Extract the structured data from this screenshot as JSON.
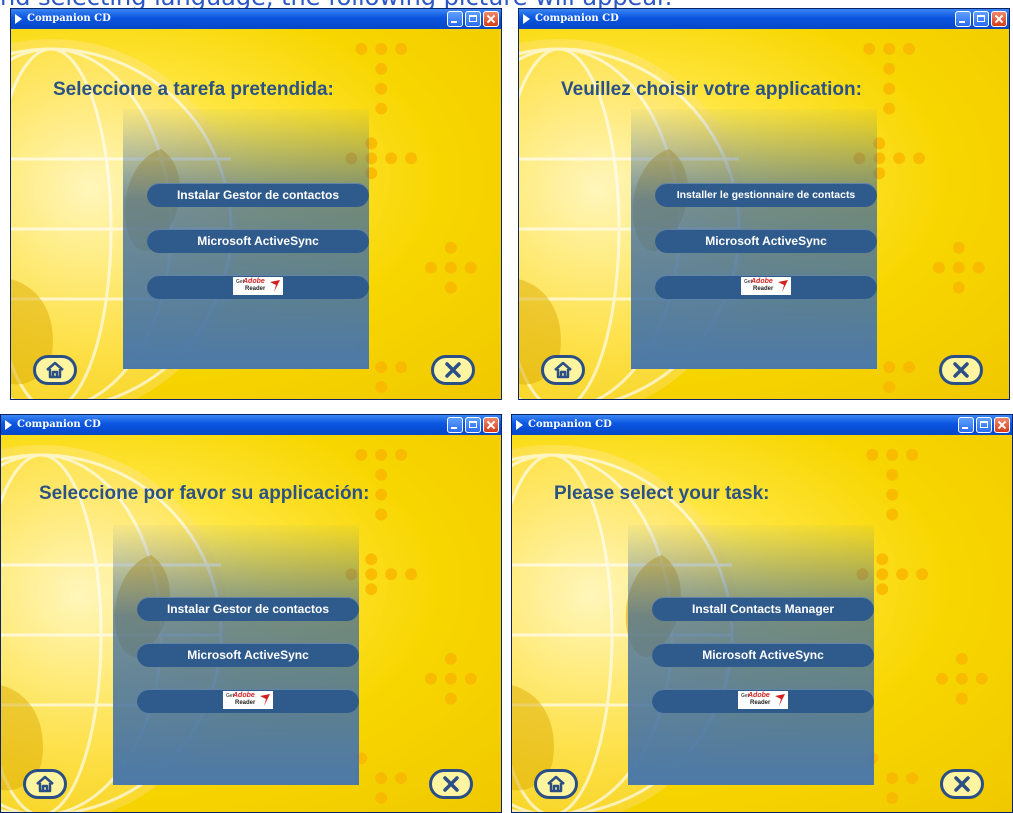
{
  "caption": "nd selecting language, the following picture will appear.",
  "colors": {
    "title_bar": "#0a55e0",
    "background": "#f6d400",
    "heading": "#2b5284",
    "button": "#2f5b8c",
    "panel": "#4c79a8"
  },
  "windows": [
    {
      "title": "Companion CD",
      "heading": "Seleccione a tarefa pretendida:",
      "buttons": [
        "Instalar Gestor de contactos",
        "Microsoft ActiveSync"
      ],
      "adobe": {
        "get": "Get",
        "brand": "Adobe",
        "product": "Reader"
      },
      "home_icon": "home-icon",
      "close_icon": "close-x-icon"
    },
    {
      "title": "Companion CD",
      "heading": "Veuillez choisir votre application:",
      "buttons": [
        "Installer le gestionnaire de contacts",
        "Microsoft ActiveSync"
      ],
      "adobe": {
        "get": "Get",
        "brand": "Adobe",
        "product": "Reader"
      },
      "home_icon": "home-icon",
      "close_icon": "close-x-icon"
    },
    {
      "title": "Companion CD",
      "heading": "Seleccione por favor su applicación:",
      "buttons": [
        "Instalar Gestor de contactos",
        "Microsoft ActiveSync"
      ],
      "adobe": {
        "get": "Get",
        "brand": "Adobe",
        "product": "Reader"
      },
      "home_icon": "home-icon",
      "close_icon": "close-x-icon"
    },
    {
      "title": "Companion CD",
      "heading": "Please select your task:",
      "buttons": [
        "Install Contacts Manager",
        "Microsoft ActiveSync"
      ],
      "adobe": {
        "get": "Get",
        "brand": "Adobe",
        "product": "Reader"
      },
      "home_icon": "home-icon",
      "close_icon": "close-x-icon"
    }
  ]
}
